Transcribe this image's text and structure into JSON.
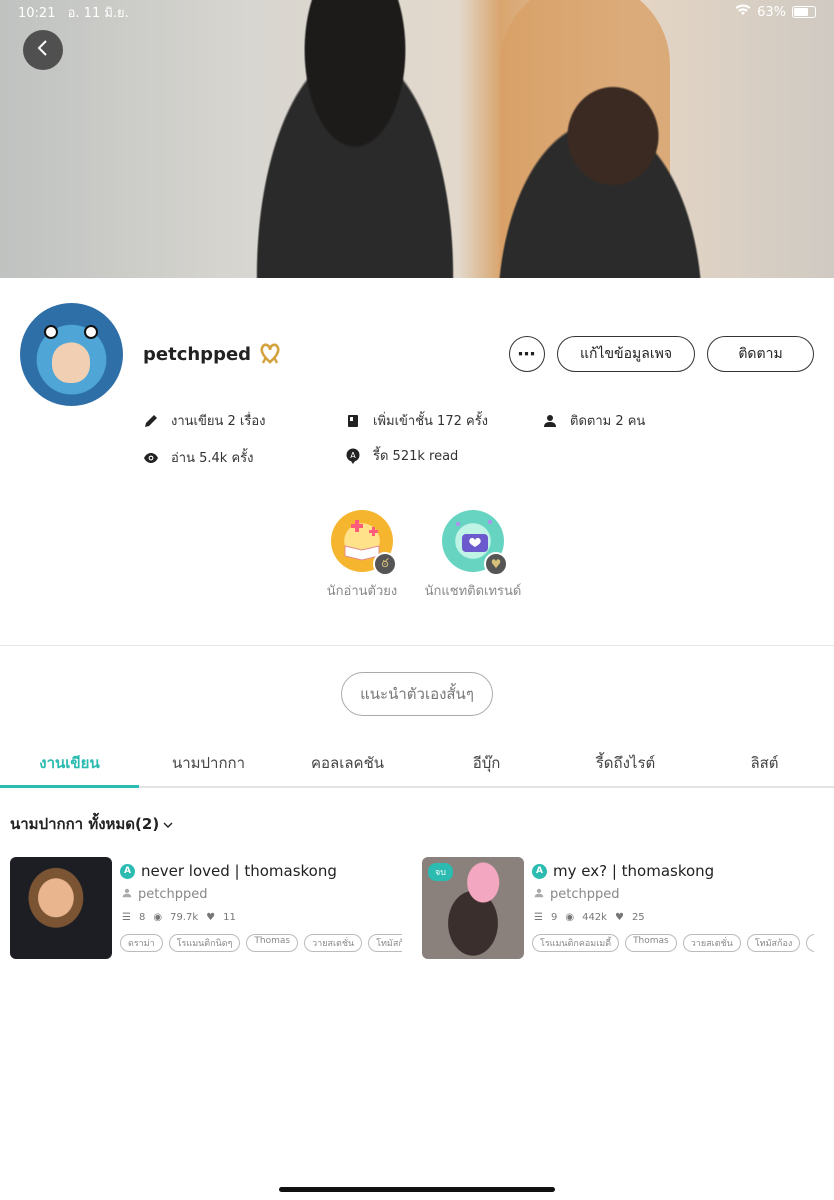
{
  "status_bar": {
    "time": "10:21",
    "date": "อ. 11 มิ.ย.",
    "battery": "63%",
    "battery_level": 0.63
  },
  "profile": {
    "name": "petchpped",
    "more_label": "⋯",
    "edit_label": "แก้ไขข้อมูลเพจ",
    "follow_label": "ติดตาม",
    "stats": {
      "works": "งานเขียน 2 เรื่อง",
      "shelf": "เพิ่มเข้าชั้น 172 ครั้ง",
      "followers": "ติดตาม 2 คน",
      "reads": "อ่าน 5.4k ครั้ง",
      "read_ticks": "รี้ด 521k read"
    }
  },
  "badges": [
    {
      "label": "นักอ่านตัวยง"
    },
    {
      "label": "นักแชทติดเทรนด์"
    }
  ],
  "intro_button": "แนะนำตัวเองสั้นๆ",
  "tabs": [
    "งานเขียน",
    "นามปากกา",
    "คอลเลคชัน",
    "อีบุ๊ก",
    "รี้ดถึงไรต์",
    "ลิสต์"
  ],
  "filter_label": "นามปากกา ทั้งหมด(2)",
  "stories": [
    {
      "title": "never loved | thomaskong",
      "author": "petchpped",
      "chapters": "8",
      "views": "79.7k",
      "likes": "11",
      "badge": "A",
      "tags": [
        "ดราม่า",
        "โรแมนติกนิดๆ",
        "Thomas",
        "วายสเตชั่น",
        "โทมัสก้อง"
      ]
    },
    {
      "title": "my ex? | thomaskong",
      "author": "petchpped",
      "chapters": "9",
      "views": "442k",
      "likes": "25",
      "badge": "A",
      "status": "จบ",
      "tags": [
        "โรแมนติกคอมเมดี้",
        "Thomas",
        "วายสเตชั่น",
        "โทมัสก้อง",
        "t"
      ]
    }
  ]
}
